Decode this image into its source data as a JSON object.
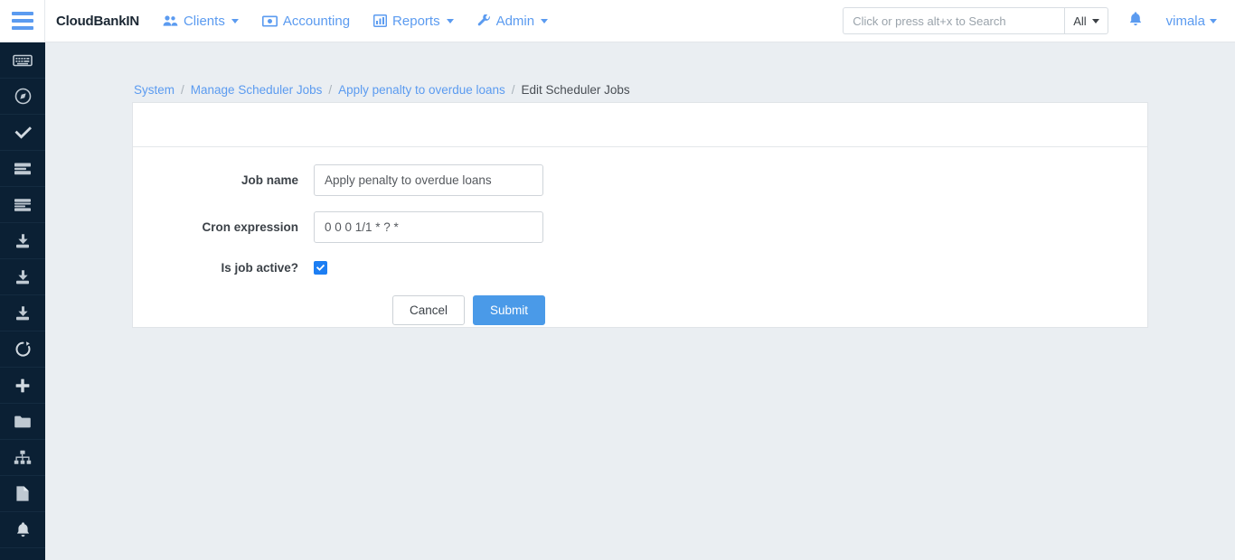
{
  "navbar": {
    "hamburger_name": "menu-toggle",
    "brand": "CloudBankIN",
    "items": [
      {
        "label": "Clients",
        "icon": "users-icon",
        "caret": true
      },
      {
        "label": "Accounting",
        "icon": "money-bill-icon",
        "caret": false
      },
      {
        "label": "Reports",
        "icon": "bar-chart-icon",
        "caret": true
      },
      {
        "label": "Admin",
        "icon": "wrench-icon",
        "caret": true
      }
    ],
    "search": {
      "placeholder": "Click or press alt+x to Search",
      "value": "",
      "scope_label": "All"
    },
    "bell_icon": "bell-icon",
    "user": "vimala"
  },
  "sidebar": {
    "items": [
      {
        "icon": "keyboard-icon"
      },
      {
        "icon": "compass-icon"
      },
      {
        "icon": "check-icon"
      },
      {
        "icon": "server-list-icon"
      },
      {
        "icon": "server-list-alt-icon"
      },
      {
        "icon": "download-icon"
      },
      {
        "icon": "download-alt-icon"
      },
      {
        "icon": "download-third-icon"
      },
      {
        "icon": "refresh-icon"
      },
      {
        "icon": "plus-icon"
      },
      {
        "icon": "folder-icon"
      },
      {
        "icon": "sitemap-icon"
      },
      {
        "icon": "file-icon"
      },
      {
        "icon": "bell-icon"
      }
    ]
  },
  "breadcrumb": [
    {
      "label": "System",
      "active": false
    },
    {
      "label": "Manage Scheduler Jobs",
      "active": false
    },
    {
      "label": "Apply penalty to overdue loans",
      "active": false
    },
    {
      "label": "Edit Scheduler Jobs",
      "active": true
    }
  ],
  "breadcrumb_separator": "/",
  "form": {
    "job_name": {
      "label": "Job name",
      "value": "Apply penalty to overdue loans"
    },
    "cron_expression": {
      "label": "Cron expression",
      "value": "0 0 0 1/1 * ? *"
    },
    "is_active": {
      "label": "Is job active?",
      "checked": true
    },
    "cancel_label": "Cancel",
    "submit_label": "Submit"
  },
  "colors": {
    "accent_blue": "#5b9bf0",
    "submit_blue": "#4a9ae8",
    "checkbox_blue": "#1c7ef3",
    "sidebar_bg": "#0b2034",
    "page_bg": "#eaeef2",
    "breadcrumb_active": "#4a4f55"
  }
}
